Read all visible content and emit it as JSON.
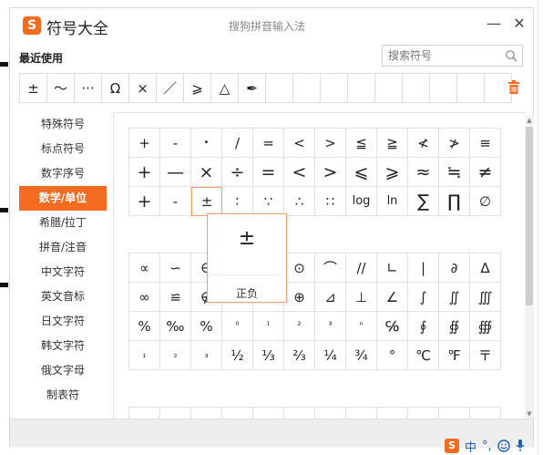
{
  "window": {
    "title": "符号大全",
    "subtitle": "搜狗拼音输入法",
    "logo_letter": "S",
    "minimize_label": "—",
    "close_label": "✕"
  },
  "recent": {
    "label": "最近使用",
    "symbols": [
      "±",
      "～",
      "···",
      "Ω",
      "×",
      "／",
      "⩾",
      "△",
      "✒",
      "",
      "",
      "",
      "",
      "",
      "",
      "",
      "",
      ""
    ]
  },
  "search": {
    "placeholder": "搜索符号"
  },
  "sidebar": {
    "items": [
      {
        "label": "特殊符号"
      },
      {
        "label": "标点符号"
      },
      {
        "label": "数字序号"
      },
      {
        "label": "数学/单位",
        "active": true
      },
      {
        "label": "希腊/拉丁"
      },
      {
        "label": "拼音/注音"
      },
      {
        "label": "中文字符"
      },
      {
        "label": "英文音标"
      },
      {
        "label": "日文字符"
      },
      {
        "label": "韩文字符"
      },
      {
        "label": "俄文字母"
      },
      {
        "label": "制表符"
      }
    ]
  },
  "grid_top": [
    "+",
    "-",
    "•",
    "/",
    "=",
    "<",
    ">",
    "≦",
    "≧",
    "≮",
    "≯",
    "≡",
    "+",
    "—",
    "×",
    "÷",
    "=",
    "<",
    ">",
    "⩽",
    "⩾",
    "≈",
    "≒",
    "≠",
    "+",
    "-",
    "±",
    "∶",
    "∵",
    "∴",
    "∷",
    "log",
    "ln",
    "∑",
    "∏",
    "∅"
  ],
  "grid_bottom": [
    "∝",
    "∽",
    "∈",
    "",
    "",
    "⊙",
    "⌒",
    "//",
    "∟",
    "|",
    "∂",
    "∆",
    "∞",
    "≌",
    "∉",
    "",
    "",
    "⊕",
    "⊿",
    "⊥",
    "∠",
    "∫",
    "∬",
    "∭",
    "%",
    "‰",
    "%",
    "⁰",
    "¹",
    "²",
    "³",
    "ⁿ",
    "℅",
    "∮",
    "∯",
    "∰",
    "₁",
    "₂",
    "₃",
    "½",
    "⅓",
    "⅔",
    "¼",
    "¾",
    "°",
    "℃",
    "℉",
    "〒"
  ],
  "popup": {
    "symbol": "±",
    "name": "正负"
  },
  "taskbar": {
    "lang": "中",
    "punct": "°,"
  }
}
